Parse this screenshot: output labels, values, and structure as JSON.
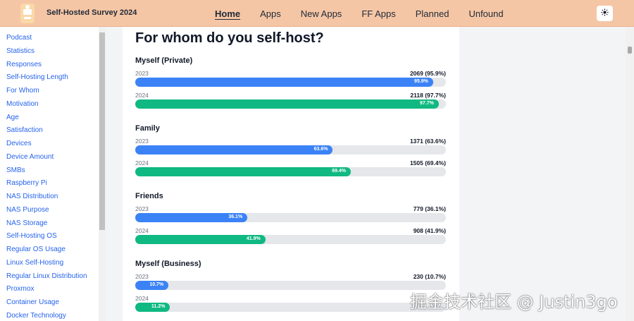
{
  "header": {
    "site_title": "Self-Hosted Survey 2024",
    "nav": [
      "Home",
      "Apps",
      "New Apps",
      "FF Apps",
      "Planned",
      "Unfound"
    ],
    "active_nav": "Home",
    "theme_icon": "sun-icon",
    "brand_color": "#f5c6a5"
  },
  "sidebar": {
    "items": [
      "Podcast",
      "Statistics",
      "Responses",
      "Self-Hosting Length",
      "For Whom",
      "Motivation",
      "Age",
      "Satisfaction",
      "Devices",
      "Device Amount",
      "SMBs",
      "Raspberry Pi",
      "NAS Distribution",
      "NAS Purpose",
      "NAS Storage",
      "Self-Hosting OS",
      "Regular OS Usage",
      "Linux Self-Hosting",
      "Regular Linux Distribution",
      "Proxmox",
      "Container Usage",
      "Docker Technology"
    ]
  },
  "main": {
    "title": "For whom do you self-host?",
    "groups": [
      {
        "title": "Myself (Private)",
        "rows": [
          {
            "year": "2023",
            "count": "2069 (95.9%)",
            "pct": 95.9,
            "label": "95.9%",
            "color": "blue"
          },
          {
            "year": "2024",
            "count": "2118 (97.7%)",
            "pct": 97.7,
            "label": "97.7%",
            "color": "green"
          }
        ]
      },
      {
        "title": "Family",
        "rows": [
          {
            "year": "2023",
            "count": "1371 (63.6%)",
            "pct": 63.6,
            "label": "63.6%",
            "color": "blue"
          },
          {
            "year": "2024",
            "count": "1505 (69.4%)",
            "pct": 69.4,
            "label": "69.4%",
            "color": "green"
          }
        ]
      },
      {
        "title": "Friends",
        "rows": [
          {
            "year": "2023",
            "count": "779 (36.1%)",
            "pct": 36.1,
            "label": "36.1%",
            "color": "blue"
          },
          {
            "year": "2024",
            "count": "908 (41.9%)",
            "pct": 41.9,
            "label": "41.9%",
            "color": "green"
          }
        ]
      },
      {
        "title": "Myself (Business)",
        "rows": [
          {
            "year": "2023",
            "count": "230 (10.7%)",
            "pct": 10.7,
            "label": "10.7%",
            "color": "blue"
          },
          {
            "year": "2024",
            "count": "",
            "pct": 11.2,
            "label": "11.2%",
            "color": "green"
          }
        ]
      }
    ]
  },
  "colors": {
    "year_2023": "#3b82f6",
    "year_2024": "#10b981",
    "track": "#e5e7eb"
  },
  "watermark": "掘金技术社区 @ Justin3go"
}
